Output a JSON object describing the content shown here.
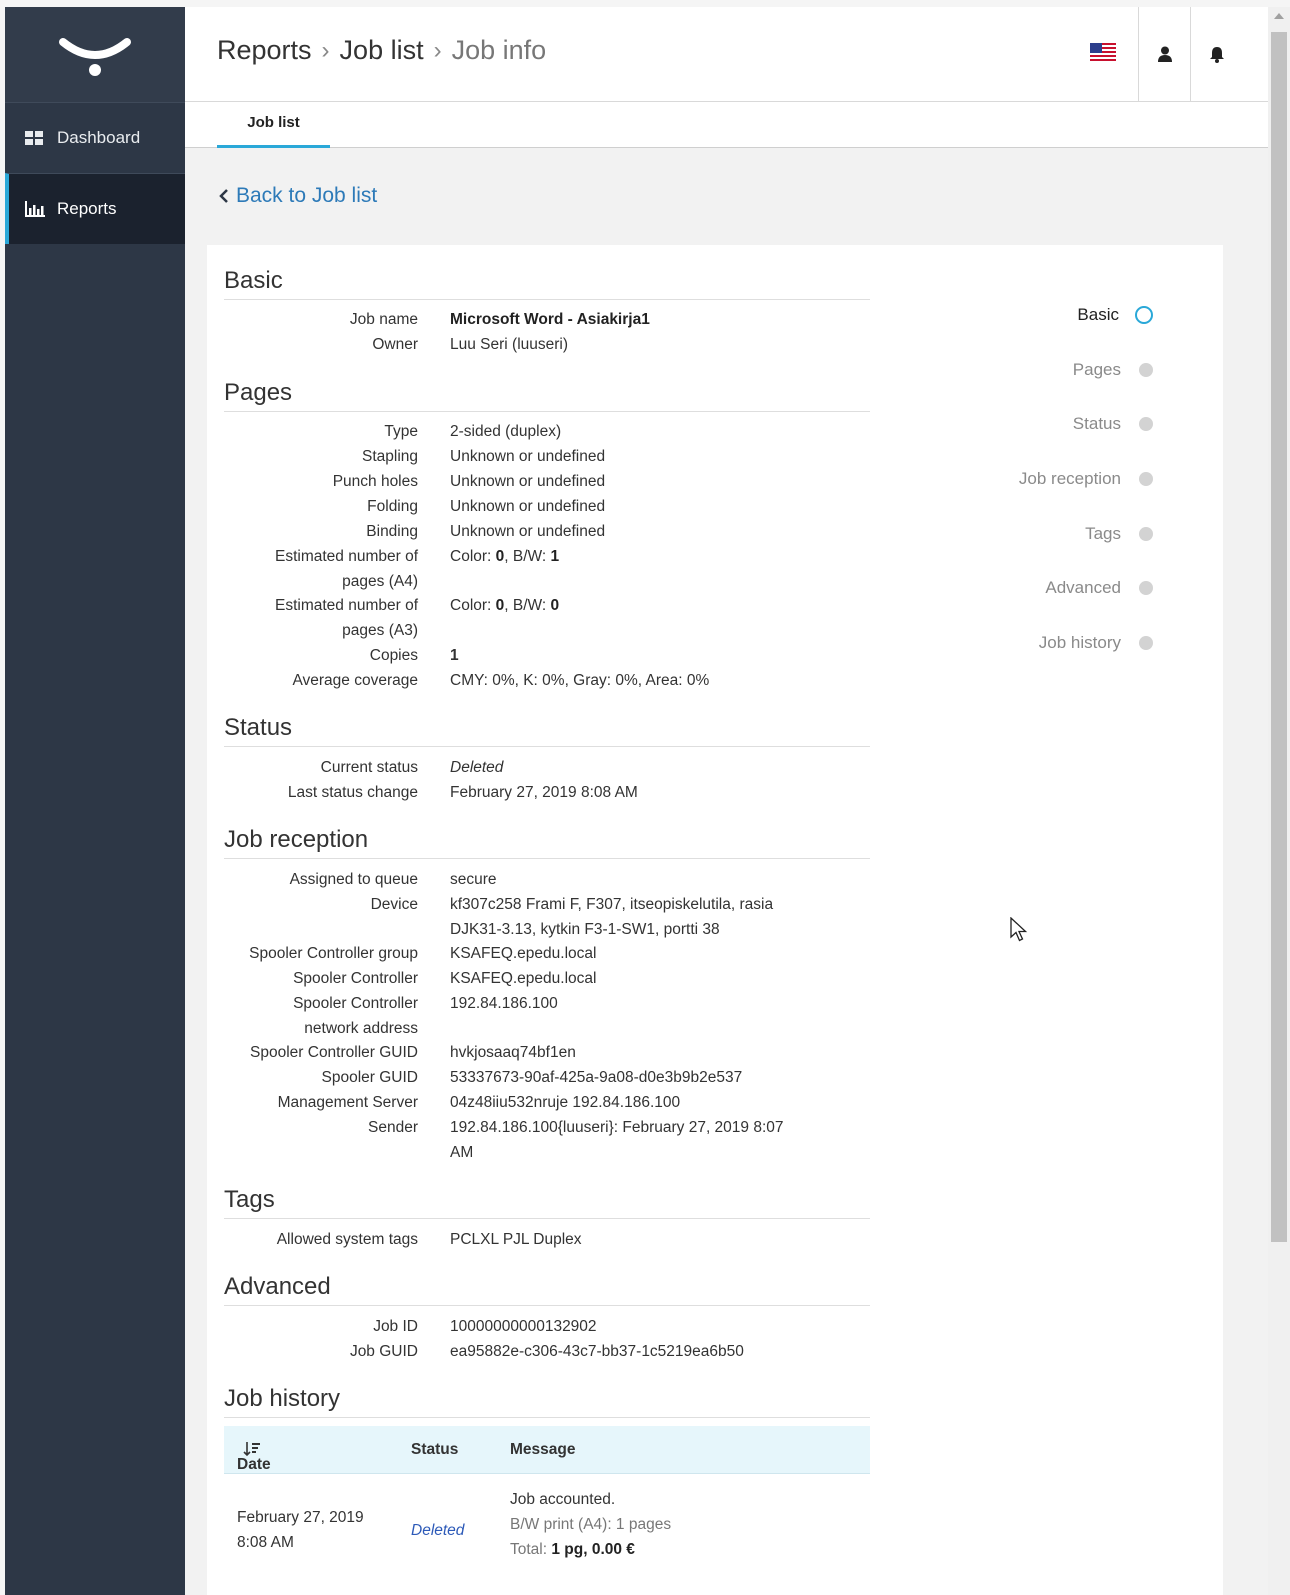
{
  "sidebar": {
    "items": [
      {
        "label": "Dashboard",
        "icon": "dashboard-icon"
      },
      {
        "label": "Reports",
        "icon": "bar-chart-icon"
      }
    ]
  },
  "header": {
    "breadcrumb": [
      "Reports",
      "Job list",
      "Job info"
    ],
    "icons": [
      "us-flag-icon",
      "user-icon",
      "bell-icon"
    ]
  },
  "tabs": [
    {
      "label": "Job list"
    }
  ],
  "back_link": "Back to Job list",
  "sections": {
    "basic": {
      "title": "Basic",
      "rows": [
        {
          "label": "Job name",
          "value": "Microsoft Word - Asiakirja1"
        },
        {
          "label": "Owner",
          "value": "Luu Seri (luuseri)"
        }
      ]
    },
    "pages": {
      "title": "Pages",
      "type": {
        "label": "Type",
        "value": "2-sided (duplex)"
      },
      "stapling": {
        "label": "Stapling",
        "value": "Unknown or undefined"
      },
      "punch": {
        "label": "Punch holes",
        "value": "Unknown or undefined"
      },
      "folding": {
        "label": "Folding",
        "value": "Unknown or undefined"
      },
      "binding": {
        "label": "Binding",
        "value": "Unknown or undefined"
      },
      "est_a4": {
        "label1": "Estimated number of",
        "label2": "pages (A4)",
        "color_label": "Color: ",
        "color": "0",
        "bw_label": ", B/W: ",
        "bw": "1"
      },
      "est_a3": {
        "label1": "Estimated number of",
        "label2": "pages (A3)",
        "color_label": "Color: ",
        "color": "0",
        "bw_label": ", B/W: ",
        "bw": "0"
      },
      "copies": {
        "label": "Copies",
        "value": "1"
      },
      "coverage": {
        "label": "Average coverage",
        "value": "CMY: 0%, K: 0%, Gray: 0%, Area: 0%"
      }
    },
    "status": {
      "title": "Status",
      "current": {
        "label": "Current status",
        "value": "Deleted"
      },
      "last_change": {
        "label": "Last status change",
        "value": "February 27, 2019 8:08 AM"
      }
    },
    "reception": {
      "title": "Job reception",
      "queue": {
        "label": "Assigned to queue",
        "value": "secure"
      },
      "device": {
        "label": "Device",
        "value1": "kf307c258 Frami F, F307, itseopiskelutila, rasia",
        "value2": "DJK31-3.13, kytkin F3-1-SW1, portti 38"
      },
      "sc_group": {
        "label": "Spooler Controller group",
        "value": "KSAFEQ.epedu.local"
      },
      "sc": {
        "label": "Spooler Controller",
        "value": "KSAFEQ.epedu.local"
      },
      "sc_addr": {
        "label1": "Spooler Controller",
        "label2": "network address",
        "value": "192.84.186.100"
      },
      "sc_guid": {
        "label": "Spooler Controller GUID",
        "value": "hvkjosaaq74bf1en"
      },
      "spooler_guid": {
        "label": "Spooler GUID",
        "value": "53337673-90af-425a-9a08-d0e3b9b2e537"
      },
      "mgmt": {
        "label": "Management Server",
        "value": "04z48iiu532nruje 192.84.186.100"
      },
      "sender": {
        "label": "Sender",
        "value1": "192.84.186.100{luuseri}: February 27, 2019 8:07",
        "value2": "AM"
      }
    },
    "tags": {
      "title": "Tags",
      "allowed": {
        "label": "Allowed system tags",
        "value": "PCLXL PJL Duplex"
      }
    },
    "advanced": {
      "title": "Advanced",
      "job_id": {
        "label": "Job ID",
        "value": "10000000000132902"
      },
      "job_guid": {
        "label": "Job GUID",
        "value": "ea95882e-c306-43c7-bb37-1c5219ea6b50"
      }
    },
    "history": {
      "title": "Job history",
      "columns": {
        "date": "Date",
        "status": "Status",
        "message": "Message"
      },
      "rows": [
        {
          "date1": "February 27, 2019",
          "date2": "8:08 AM",
          "status": "Deleted",
          "msg1": "Job accounted.",
          "msg2": "B/W print (A4): 1 pages",
          "msg_total_label": "Total: ",
          "msg_total_value": "1 pg, 0.00 €"
        }
      ]
    }
  },
  "right_nav": [
    "Basic",
    "Pages",
    "Status",
    "Job reception",
    "Tags",
    "Advanced",
    "Job history"
  ],
  "colors": {
    "accent": "#2aa8d8",
    "sidebar": "#2d3746",
    "link": "#2d7ab8"
  }
}
